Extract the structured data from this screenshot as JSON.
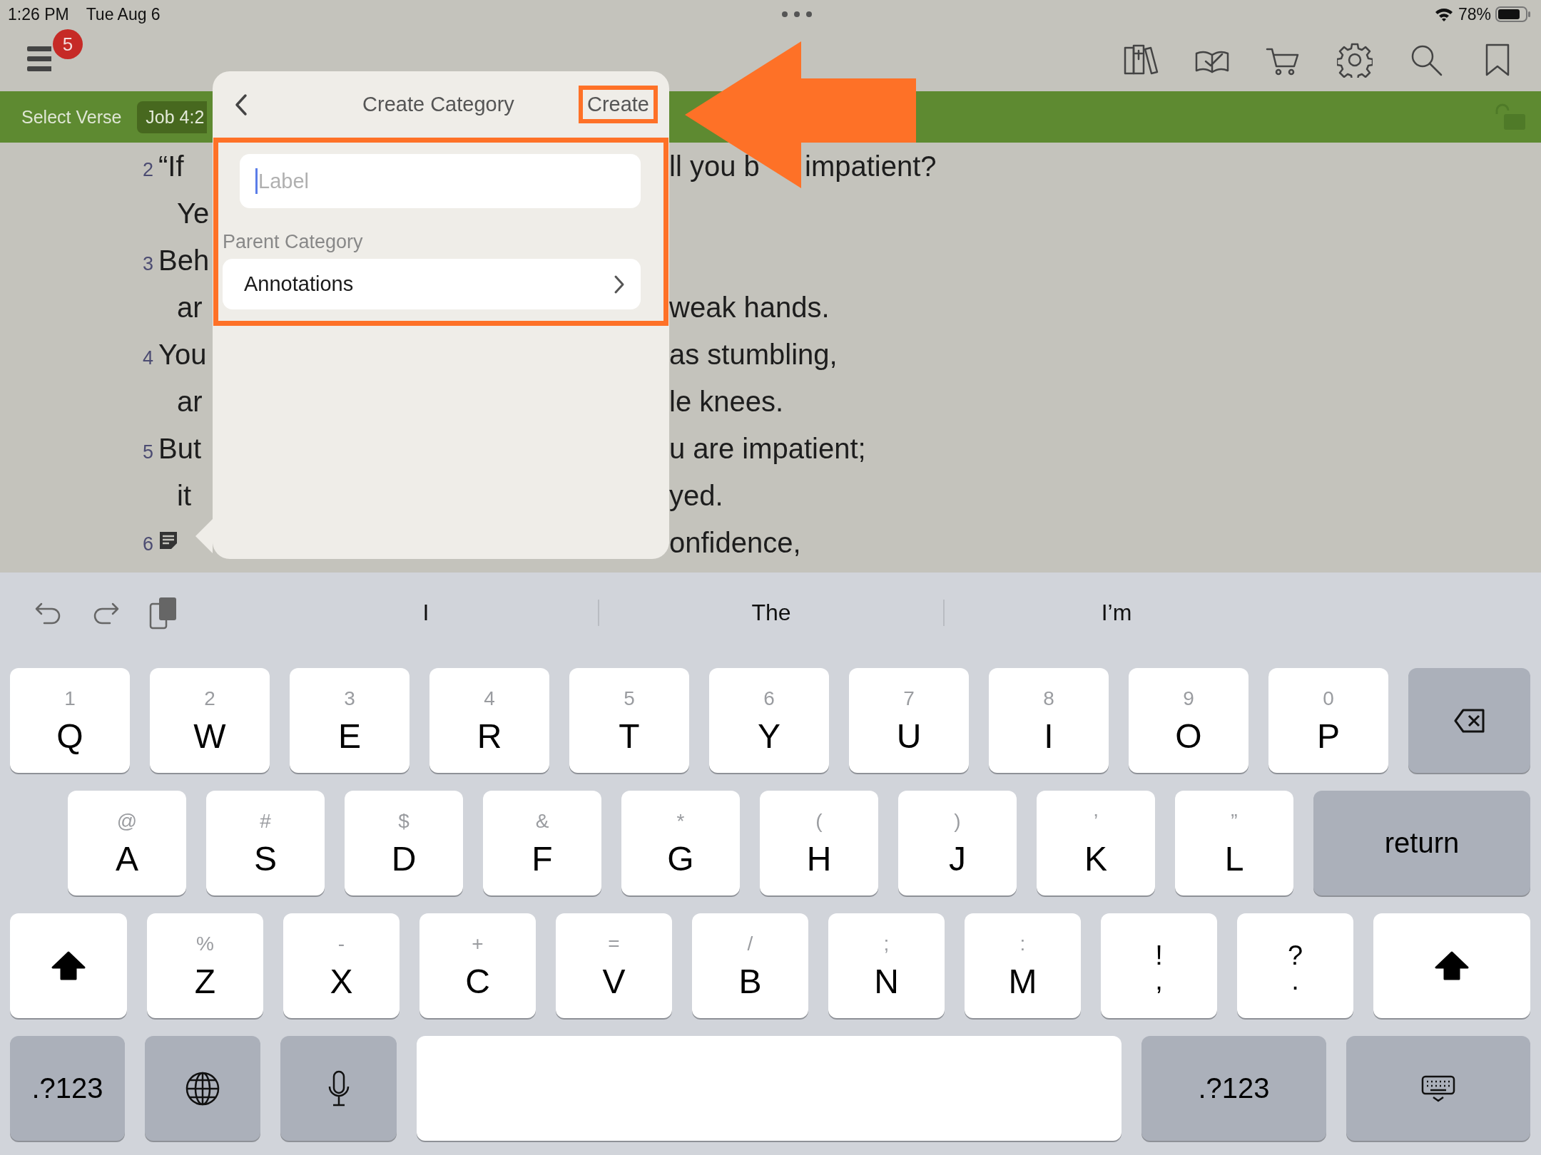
{
  "status_bar": {
    "time": "1:26 PM",
    "date": "Tue Aug 6",
    "battery": "78%"
  },
  "toolbar": {
    "badge": "5"
  },
  "verse_bar": {
    "select_label": "Select Verse",
    "reference": "Job 4:2"
  },
  "passage": [
    {
      "kind": "verse",
      "number": "2",
      "text": "“If",
      "right": [
        "ll you b",
        "impatient?"
      ]
    },
    {
      "kind": "continuation",
      "text": "Ye"
    },
    {
      "kind": "verse",
      "number": "3",
      "text": "Beh"
    },
    {
      "kind": "continuation",
      "text": "ar",
      "right": [
        "weak hands."
      ]
    },
    {
      "kind": "verse",
      "number": "4",
      "text": "You",
      "right": [
        "as stumbling,"
      ]
    },
    {
      "kind": "continuation",
      "text": "ar",
      "right": [
        "le knees."
      ]
    },
    {
      "kind": "verse",
      "number": "5",
      "text": "But",
      "right": [
        "u are impatient;"
      ]
    },
    {
      "kind": "continuation",
      "text": "it",
      "right": [
        "yed."
      ]
    },
    {
      "kind": "note",
      "number": "6",
      "right": [
        "onfidence,"
      ]
    }
  ],
  "popover": {
    "title": "Create Category",
    "action": "Create",
    "action_highlighted": true,
    "content_highlighted": true,
    "field": {
      "placeholder": "Label"
    },
    "section": "Parent Category",
    "parent": {
      "value": "Annotations"
    }
  },
  "keyboard": {
    "suggestions": [
      "I",
      "The",
      "I’m"
    ],
    "rows": [
      [
        {
          "kind": "letter",
          "label": "Q",
          "alt": "1"
        },
        {
          "kind": "letter",
          "label": "W",
          "alt": "2"
        },
        {
          "kind": "letter",
          "label": "E",
          "alt": "3"
        },
        {
          "kind": "letter",
          "label": "R",
          "alt": "4"
        },
        {
          "kind": "letter",
          "label": "T",
          "alt": "5"
        },
        {
          "kind": "letter",
          "label": "Y",
          "alt": "6"
        },
        {
          "kind": "letter",
          "label": "U",
          "alt": "7"
        },
        {
          "kind": "letter",
          "label": "I",
          "alt": "8"
        },
        {
          "kind": "letter",
          "label": "O",
          "alt": "9"
        },
        {
          "kind": "letter",
          "label": "P",
          "alt": "0"
        },
        {
          "kind": "delete"
        }
      ],
      [
        {
          "kind": "letter",
          "label": "A",
          "alt": "@"
        },
        {
          "kind": "letter",
          "label": "S",
          "alt": "#"
        },
        {
          "kind": "letter",
          "label": "D",
          "alt": "$"
        },
        {
          "kind": "letter",
          "label": "F",
          "alt": "&"
        },
        {
          "kind": "letter",
          "label": "G",
          "alt": "*"
        },
        {
          "kind": "letter",
          "label": "H",
          "alt": "("
        },
        {
          "kind": "letter",
          "label": "J",
          "alt": ")"
        },
        {
          "kind": "letter",
          "label": "K",
          "alt": "’"
        },
        {
          "kind": "letter",
          "label": "L",
          "alt": "”"
        },
        {
          "kind": "return",
          "label": "return"
        }
      ],
      [
        {
          "kind": "shift",
          "on": true
        },
        {
          "kind": "letter",
          "label": "Z",
          "alt": "%"
        },
        {
          "kind": "letter",
          "label": "X",
          "alt": "-"
        },
        {
          "kind": "letter",
          "label": "C",
          "alt": "+"
        },
        {
          "kind": "letter",
          "label": "V",
          "alt": "="
        },
        {
          "kind": "letter",
          "label": "B",
          "alt": "/"
        },
        {
          "kind": "letter",
          "label": "N",
          "alt": ";"
        },
        {
          "kind": "letter",
          "label": "M",
          "alt": ":"
        },
        {
          "kind": "dual",
          "top": "!",
          "label": ","
        },
        {
          "kind": "dual",
          "top": "?",
          "label": "."
        },
        {
          "kind": "shift",
          "on": true
        }
      ],
      [
        {
          "kind": "mode",
          "label": ".?123"
        },
        {
          "kind": "globe"
        },
        {
          "kind": "mic"
        },
        {
          "kind": "space"
        },
        {
          "kind": "mode",
          "label": ".?123"
        },
        {
          "kind": "hide"
        }
      ]
    ]
  }
}
